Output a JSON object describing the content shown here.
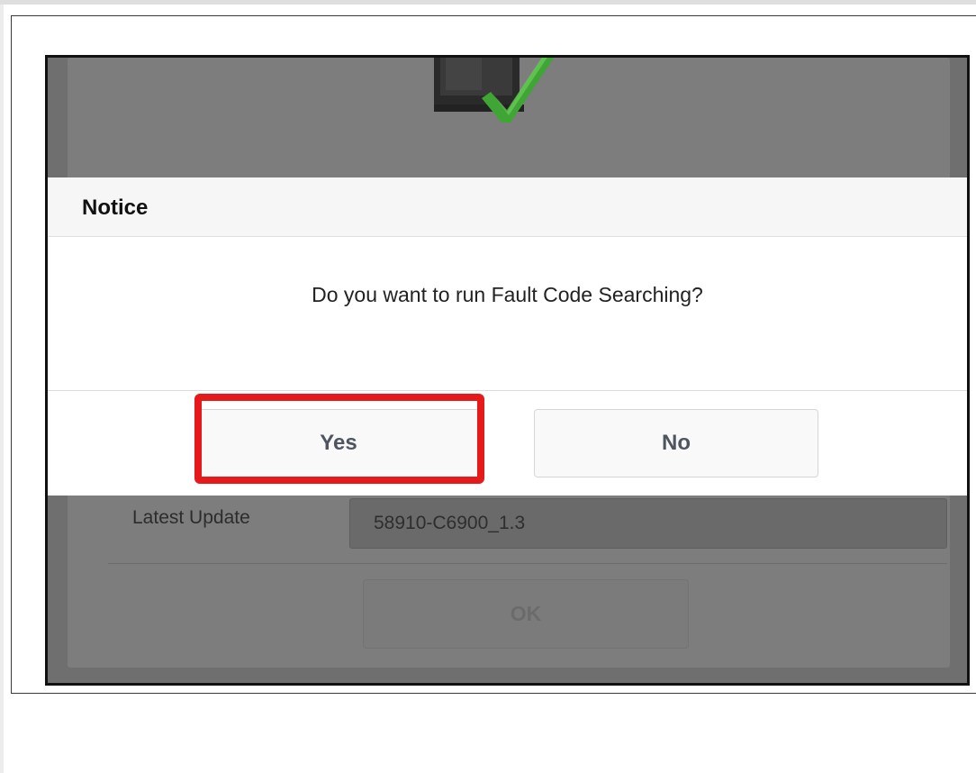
{
  "dialog": {
    "title": "Notice",
    "message": "Do you want to run Fault Code Searching?",
    "yes_label": "Yes",
    "no_label": "No"
  },
  "background": {
    "latest_update_label": "Latest Update",
    "latest_update_value": "58910-C6900_1.3",
    "ok_label": "OK"
  },
  "icons": {
    "device": "device-check-icon"
  },
  "colors": {
    "highlight": "#e61a1a",
    "overlay": "#6f6f6f",
    "check_green": "#3fa535"
  }
}
